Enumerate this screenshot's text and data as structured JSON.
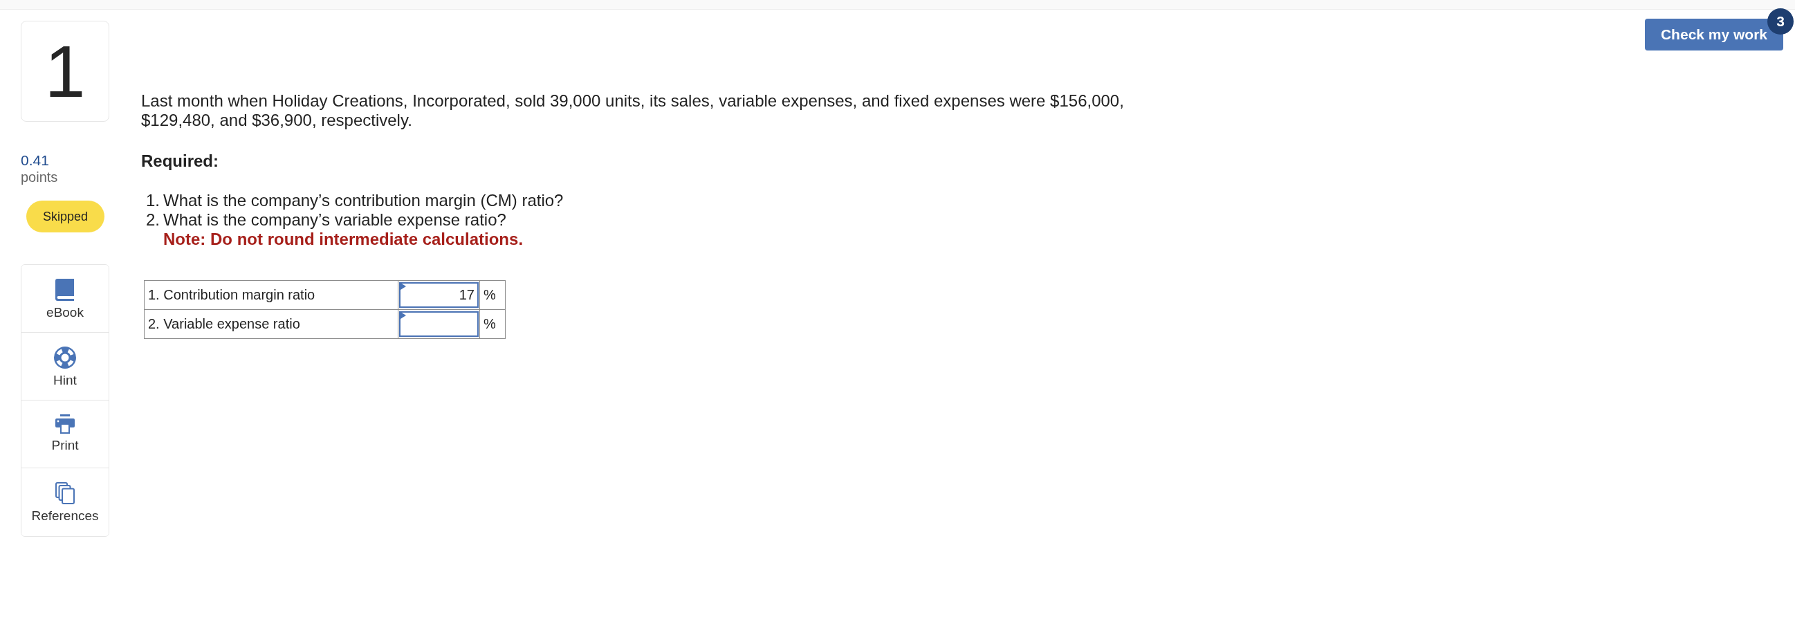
{
  "question": {
    "number": "1",
    "points": "0.41",
    "points_label": "points",
    "status": "Skipped"
  },
  "tools": [
    {
      "kind": "ebook",
      "label": "eBook"
    },
    {
      "kind": "hint",
      "label": "Hint"
    },
    {
      "kind": "print",
      "label": "Print"
    },
    {
      "kind": "references",
      "label": "References"
    }
  ],
  "problem": {
    "text": "Last month when Holiday Creations, Incorporated, sold 39,000 units, its sales, variable expenses, and fixed expenses were $156,000, $129,480, and $36,900, respectively.",
    "required_heading": "Required:",
    "questions": [
      {
        "number": "1.",
        "text": "What is the company’s contribution margin (CM) ratio?"
      },
      {
        "number": "2.",
        "text": "What is the company’s variable expense ratio?"
      }
    ],
    "note": "Note: Do not round intermediate calculations."
  },
  "answer_table": {
    "rows": [
      {
        "label": "1. Contribution margin ratio",
        "value": "17",
        "unit": "%"
      },
      {
        "label": "2. Variable expense ratio",
        "unit": "%"
      }
    ]
  },
  "header": {
    "check_button": {
      "label": "Check my work",
      "badge": "3"
    }
  }
}
